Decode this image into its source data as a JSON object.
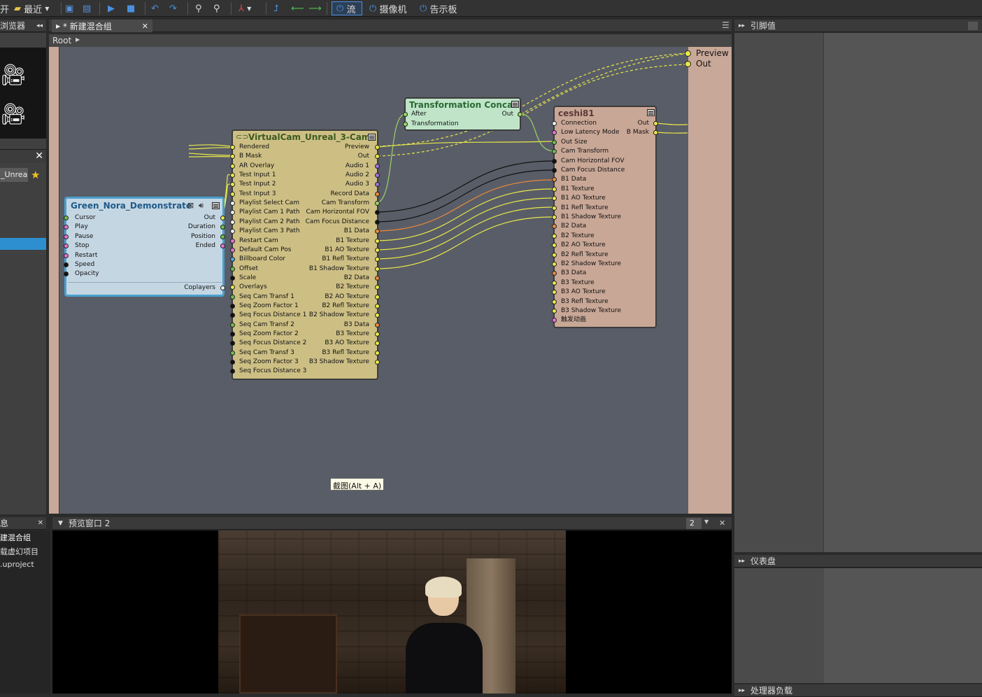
{
  "toolbar": {
    "open_partial": "开",
    "recent": "最近",
    "flow": "流",
    "camera": "摄像机",
    "board": "告示板"
  },
  "browser": {
    "title": "浏览器",
    "item_label": "_Unrea"
  },
  "composition": {
    "tab": "* 新建混合组",
    "breadcrumb": "Root"
  },
  "right_panels": {
    "refs": "引脚值",
    "dashboard": "仪表盘",
    "processor": "处理器负载"
  },
  "info": {
    "title": "息",
    "lines": [
      "建混合组",
      "载虚幻项目",
      ".uproject"
    ]
  },
  "preview": {
    "tab": "预览窗口 2",
    "number": "2"
  },
  "tooltip": "截图(Alt + A)",
  "outputs": [
    "Preview",
    "Out"
  ],
  "nodes": {
    "green": {
      "title": "Green_Nora_Demonstrate",
      "in": [
        "Cursor",
        "Play",
        "Pause",
        "Stop",
        "Restart",
        "Speed",
        "Opacity"
      ],
      "out": [
        "Out",
        "Duration",
        "Position",
        "Ended"
      ],
      "footer": "Coplayers"
    },
    "vcam": {
      "title": "VirtualCam_Unreal_3-Cam",
      "in": [
        "Rendered",
        "B Mask",
        "AR Overlay",
        "Test Input 1",
        "Test Input 2",
        "Test Input 3",
        "Playlist Select Cam",
        "Playlist Cam 1 Path",
        "Playlist Cam 2 Path",
        "Playlist Cam 3 Path",
        "Restart Cam",
        "Default Cam Pos",
        "Billboard Color",
        "Offset",
        "Scale",
        "Overlays",
        "Seq Cam Transf 1",
        "Seq Zoom Factor 1",
        "Seq Focus Distance 1",
        "Seq Cam Transf 2",
        "Seq Zoom Factor 2",
        "Seq Focus Distance 2",
        "Seq Cam Transf 3",
        "Seq Zoom Factor 3",
        "Seq Focus Distance 3"
      ],
      "out": [
        "Preview",
        "Out",
        "Audio 1",
        "Audio 2",
        "Audio 3",
        "Record Data",
        "Cam Transform",
        "Cam Horizontal FOV",
        "Cam Focus Distance",
        "B1 Data",
        "B1 Texture",
        "B1 AO Texture",
        "B1 Refl Texture",
        "B1 Shadow Texture",
        "B2 Data",
        "B2 Texture",
        "B2 AO Texture",
        "B2 Refl Texture",
        "B2 Shadow Texture",
        "B3 Data",
        "B3 Texture",
        "B3 AO Texture",
        "B3 Refl Texture",
        "B3 Shadow Texture"
      ]
    },
    "tconcat": {
      "title": "Transformation Concat",
      "in": [
        "After",
        "Transformation"
      ],
      "out": [
        "Out"
      ]
    },
    "ceshi": {
      "title": "ceshi81",
      "in": [
        "Connection",
        "Low Latency Mode",
        "Out Size",
        "Cam Transform",
        "Cam Horizontal FOV",
        "Cam Focus Distance",
        "B1 Data",
        "B1 Texture",
        "B1 AO Texture",
        "B1 Refl Texture",
        "B1 Shadow Texture",
        "B2 Data",
        "B2 Texture",
        "B2 AO Texture",
        "B2 Refl Texture",
        "B2 Shadow Texture",
        "B3 Data",
        "B3 Texture",
        "B3 AO Texture",
        "B3 Refl Texture",
        "B3 Shadow Texture",
        "触发动画"
      ],
      "out": [
        "Out",
        "B Mask"
      ]
    }
  }
}
